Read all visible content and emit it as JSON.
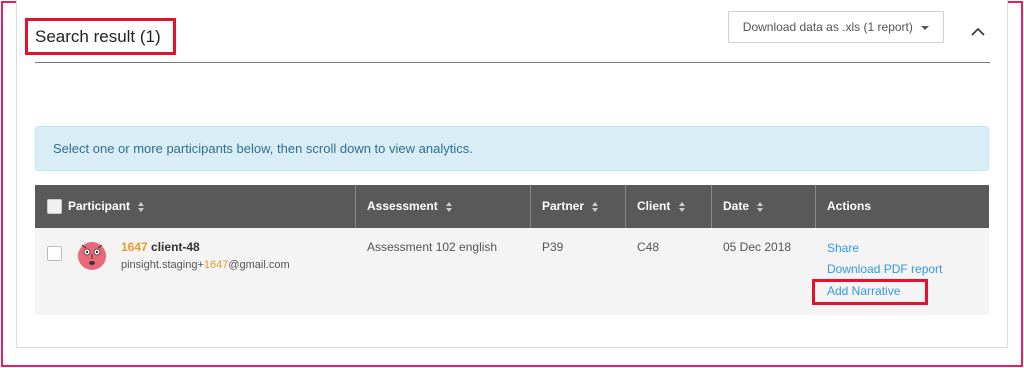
{
  "header": {
    "title": "Search result (1)",
    "download_label": "Download data as .xls (1 report)"
  },
  "alert": {
    "text": "Select one or more participants below, then scroll down to view analytics."
  },
  "table": {
    "columns": [
      "Participant",
      "Assessment",
      "Partner",
      "Client",
      "Date",
      "Actions"
    ],
    "rows": [
      {
        "participant_id": "1647",
        "participant_name": "client-48",
        "email_prefix": "pinsight.staging+",
        "email_id": "1647",
        "email_suffix": "@gmail.com",
        "assessment": "Assessment 102 english",
        "partner": "P39",
        "client": "C48",
        "date": "05 Dec 2018",
        "actions": {
          "share": "Share",
          "download_pdf": "Download PDF report",
          "add_narrative": "Add Narrative"
        }
      }
    ]
  },
  "colors": {
    "highlight": "#e8112d",
    "header_bg": "#595959",
    "alert_bg": "#d9edf7",
    "link": "#3399dd",
    "accent_orange": "#e89a2e"
  }
}
